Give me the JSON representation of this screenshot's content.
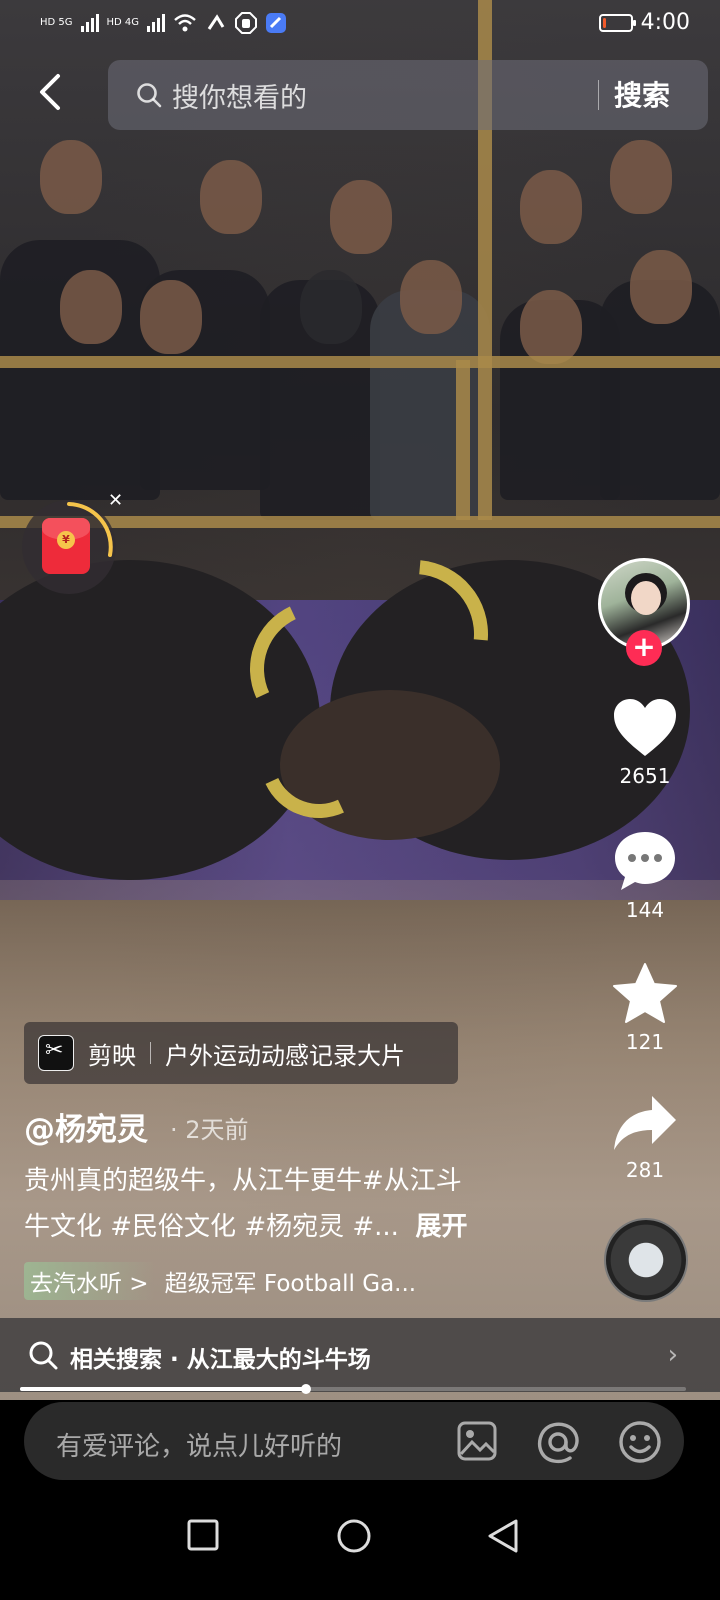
{
  "status_bar": {
    "network_left": "HD 5G",
    "network_right": "HD 4G",
    "battery_level": 0.15,
    "time": "4:00"
  },
  "search": {
    "placeholder": "搜你想看的",
    "button": "搜索"
  },
  "side": {
    "likes": "2651",
    "comments": "144",
    "favorites": "121",
    "shares": "281"
  },
  "capcut_tag": {
    "app": "剪映",
    "template": "户外运动动感记录大片"
  },
  "post": {
    "author": "@杨宛灵",
    "time": "· 2天前",
    "desc_line1": "贵州真的超级牛，从江牛更牛#从江斗",
    "desc_line2": "牛文化 #民俗文化 #杨宛灵 #...",
    "expand": "展开",
    "music_tag": "去汽水听 >",
    "music_title": "超级冠军 Football Ga..."
  },
  "related": {
    "text": "相关搜索 · 从江最大的斗牛场"
  },
  "progress": 0.43,
  "comment": {
    "placeholder": "有爱评论，说点儿好听的"
  },
  "colors": {
    "accent": "#fe2c55",
    "red_packet": "#ee2b3a",
    "battery": "#f25a2b"
  }
}
